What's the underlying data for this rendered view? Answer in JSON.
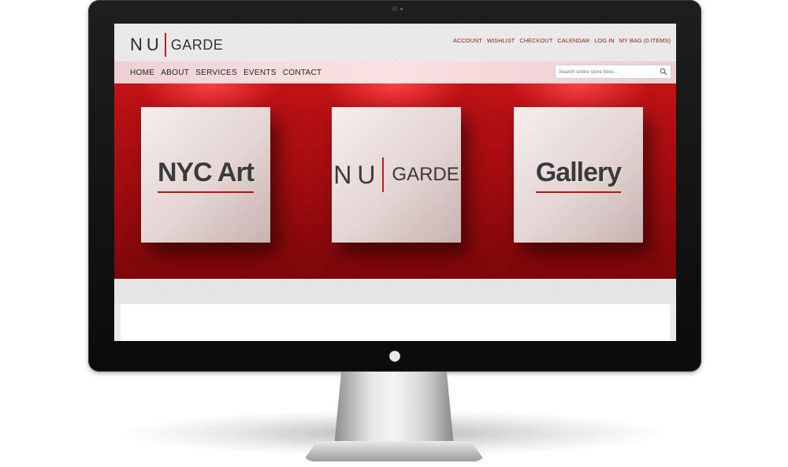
{
  "site": {
    "logo": {
      "nu": "NU",
      "garde": "GARDE"
    },
    "top_links": [
      "ACCOUNT",
      "WISHLIST",
      "CHECKOUT",
      "CALENDAR",
      "LOG IN",
      "MY BAG (0 ITEMS)"
    ],
    "nav": [
      "HOME",
      "ABOUT",
      "SERVICES",
      "EVENTS",
      "CONTACT"
    ],
    "search": {
      "placeholder": "Search entire store here..."
    },
    "hero": {
      "panel_left": "NYC Art",
      "panel_center_logo": {
        "nu": "NU",
        "garde": "GARDE"
      },
      "panel_right": "Gallery"
    }
  },
  "colors": {
    "accent_red": "#c8171e",
    "hero_red": "#a40d10",
    "link_red": "#9b1b1b"
  },
  "icons": {
    "search": "search-icon",
    "apple": "apple-logo-icon"
  }
}
